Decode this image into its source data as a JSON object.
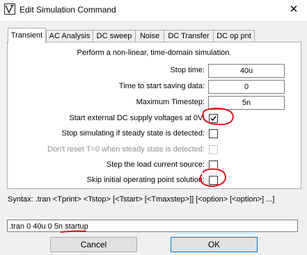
{
  "window": {
    "title": "Edit Simulation Command",
    "close_glyph": "✕",
    "app_icon": "ltspice-icon"
  },
  "tabs": [
    "Transient",
    "AC Analysis",
    "DC sweep",
    "Noise",
    "DC Transfer",
    "DC op pnt"
  ],
  "transient": {
    "description": "Perform a non-linear, time-domain simulation.",
    "fields": [
      {
        "label": "Stop time:",
        "value": "40u"
      },
      {
        "label": "Time to start saving data:",
        "value": "0"
      },
      {
        "label": "Maximum Timestep:",
        "value": "5n"
      }
    ],
    "checkboxes": [
      {
        "label": "Start external DC supply voltages at 0V:",
        "checked": true,
        "enabled": true
      },
      {
        "label": "Stop simulating if steady state is detected:",
        "checked": false,
        "enabled": true
      },
      {
        "label": "Don't reset T=0 when steady state is detected:",
        "checked": false,
        "enabled": false
      },
      {
        "label": "Step the load current source:",
        "checked": false,
        "enabled": true
      },
      {
        "label": "Skip initial operating point solution:",
        "checked": false,
        "enabled": true
      }
    ]
  },
  "syntax": "Syntax:  .tran <Tprint> <Tstop> [<Tstart> [<Tmaxstep>]] [<option> [<option>] ...]",
  "command": ".tran 0 40u 0 5n startup",
  "buttons": {
    "cancel": "Cancel",
    "ok": "OK"
  },
  "annotation_color": "#e0141e"
}
